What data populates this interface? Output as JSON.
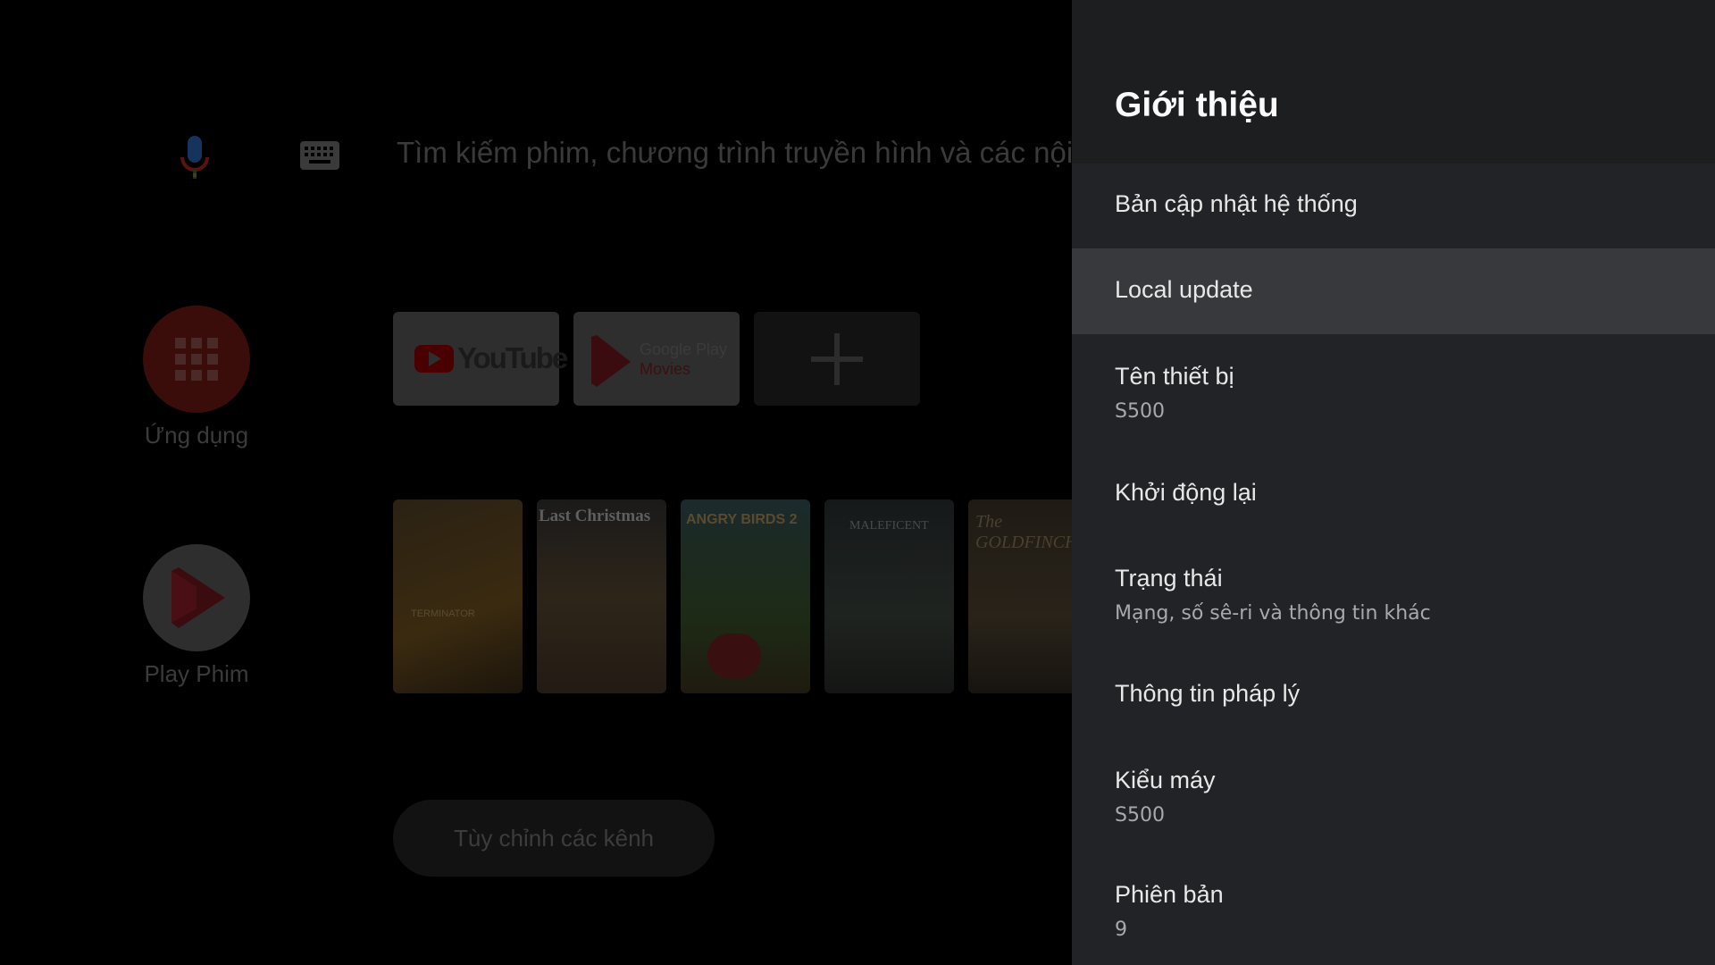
{
  "home": {
    "search_placeholder": "Tìm kiếm phim, chương trình truyền hình và các nội d",
    "apps_label": "Ứng dụng",
    "play_movies_label": "Play Phim",
    "youtube_label": "YouTube",
    "google_play_line1": "Google Play",
    "google_play_line2": "Movies",
    "customize_label": "Tùy chỉnh các kênh",
    "poster_texts": {
      "terminator": "TERMINATOR",
      "last_christmas": "Last Christmas",
      "angry_birds": "ANGRY BIRDS 2",
      "maleficent": "MALEFICENT",
      "goldfinch": "The GOLDFINCH"
    }
  },
  "panel": {
    "title": "Giới thiệu",
    "items": [
      {
        "title": "Bản cập nhật hệ thống",
        "subtitle": ""
      },
      {
        "title": "Local update",
        "subtitle": ""
      },
      {
        "title": "Tên thiết bị",
        "subtitle": "S500"
      },
      {
        "title": "Khởi động lại",
        "subtitle": ""
      },
      {
        "title": "Trạng thái",
        "subtitle": "Mạng, số sê-ri và thông tin khác"
      },
      {
        "title": "Thông tin pháp lý",
        "subtitle": ""
      },
      {
        "title": "Kiểu máy",
        "subtitle": "S500"
      },
      {
        "title": "Phiên bản",
        "subtitle": "9"
      }
    ]
  },
  "colors": {
    "panel_bg": "#222326",
    "focused_item": "#38393c",
    "apps_circle": "#3a0d0b",
    "youtube_red": "#ff0000"
  },
  "icons": [
    "mic-icon",
    "keyboard-icon",
    "apps-grid-icon",
    "play-movies-icon",
    "plus-icon",
    "youtube-logo-icon",
    "google-play-movies-icon"
  ]
}
